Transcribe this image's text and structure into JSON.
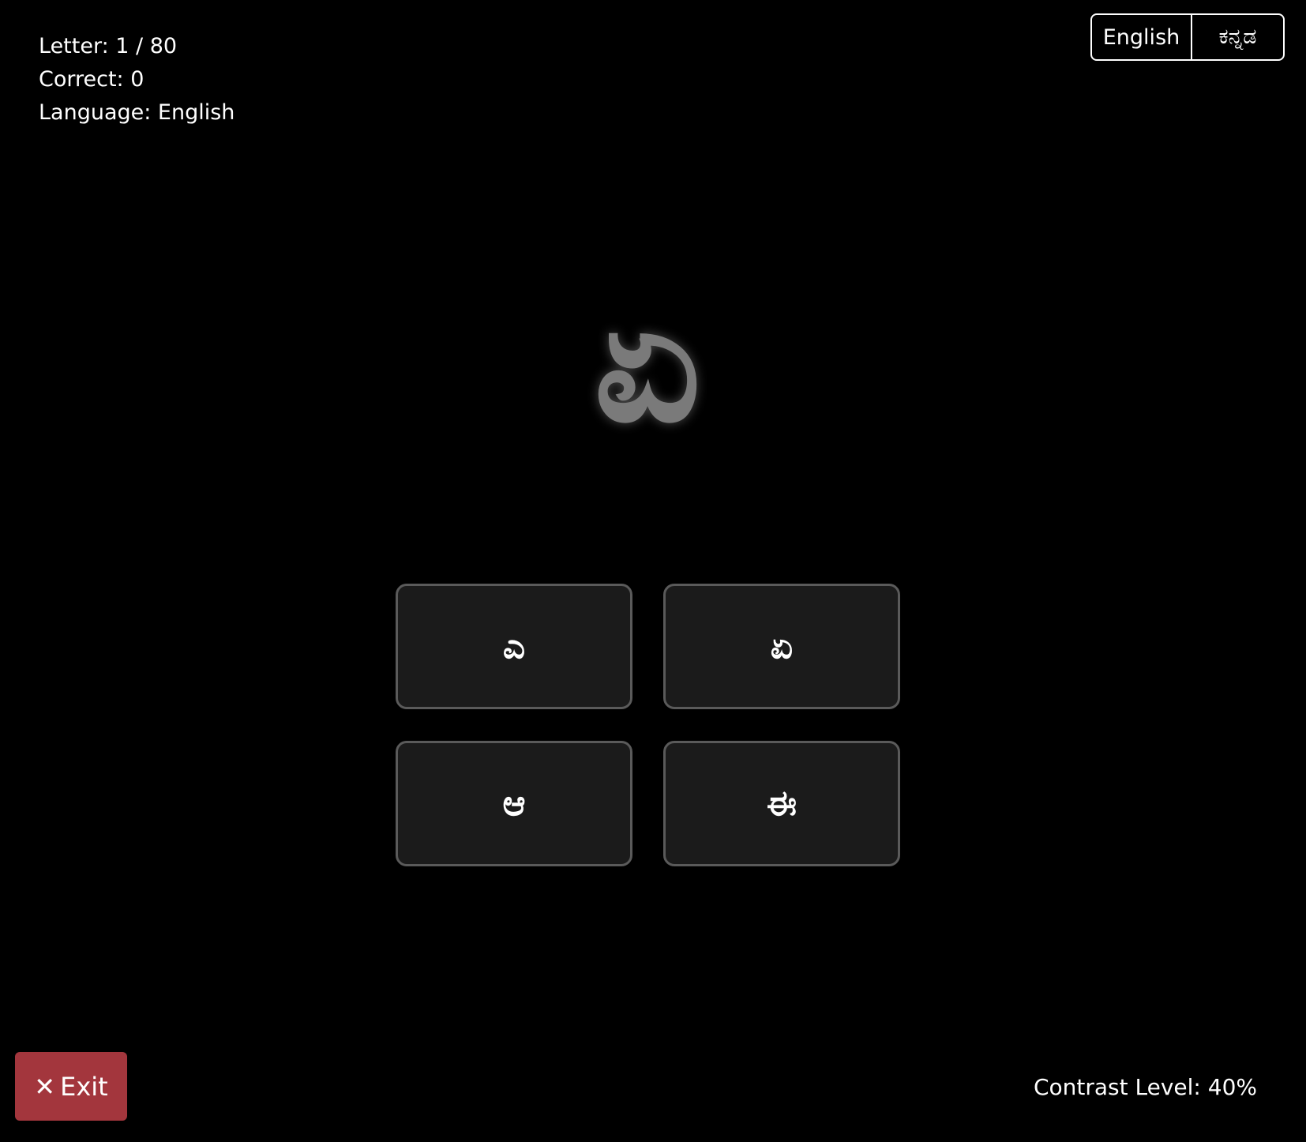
{
  "stats": {
    "letter": "Letter: 1 / 80",
    "correct": "Correct: 0",
    "language": "Language: English"
  },
  "language_toggle": {
    "english_label": "English",
    "kannada_label": "ಕನ್ನಡ",
    "selected": "English"
  },
  "target_letter": "ಏ",
  "target_letter_color": "#7a7a7a",
  "options": [
    {
      "label": "ಎ"
    },
    {
      "label": "ಏ"
    },
    {
      "label": "ಆ"
    },
    {
      "label": "ಈ"
    }
  ],
  "exit": {
    "icon": "close-icon",
    "icon_glyph": "✕",
    "label": "Exit",
    "color": "#a3363d"
  },
  "contrast": "Contrast Level: 40%"
}
